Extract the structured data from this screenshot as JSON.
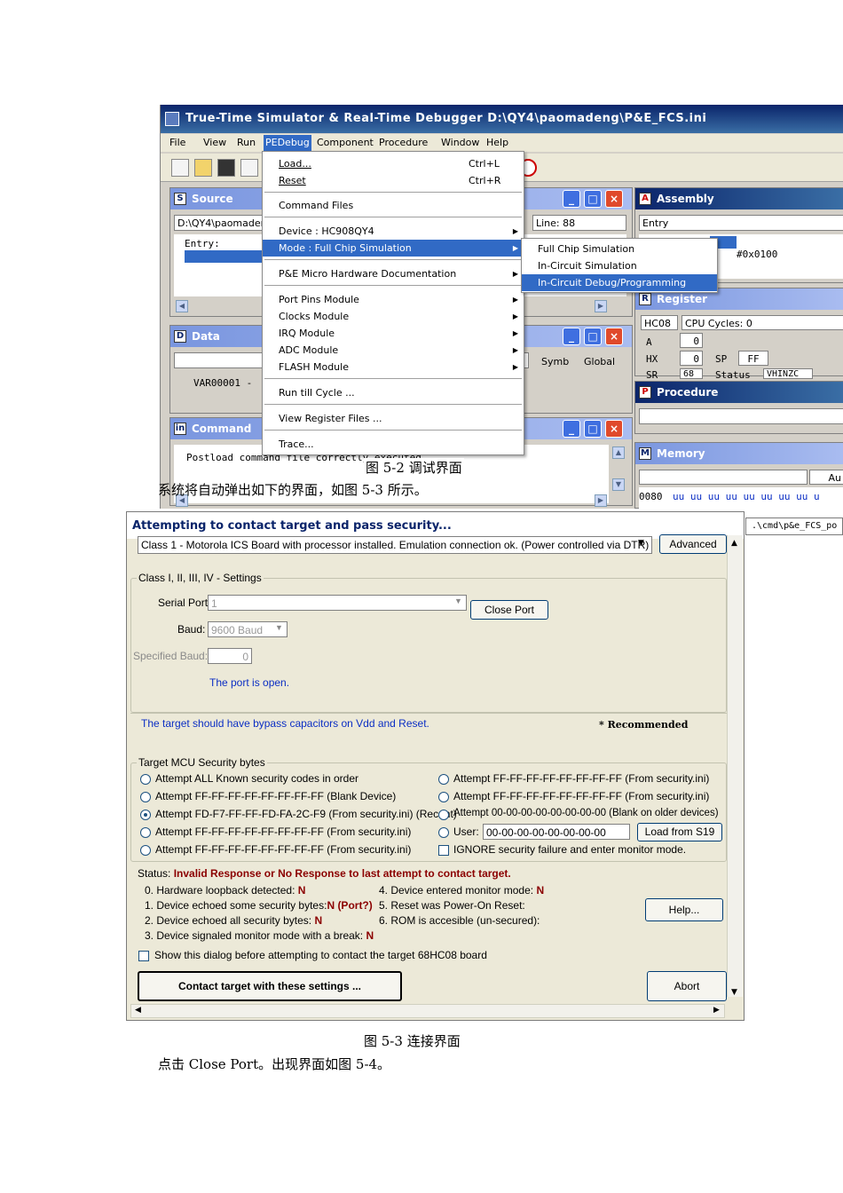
{
  "fig1": {
    "title": "True-Time Simulator & Real-Time Debugger   D:\\QY4\\paomadeng\\P&E_FCS.ini",
    "menu": {
      "file": "File",
      "view": "View",
      "run": "Run",
      "pedebug": "PEDebug",
      "component": "Component",
      "procedure": "Procedure",
      "window": "Window",
      "help": "Help"
    },
    "source": {
      "title": "Source",
      "path": "D:\\QY4\\paomader",
      "line": "Line: 88",
      "entry": "Entry:"
    },
    "data": {
      "title": "Data",
      "var": "VAR00001  -",
      "symb": "Symb",
      "global": "Global"
    },
    "command": {
      "title": "Command",
      "text": "Postload command file correctly executed."
    },
    "assembly": {
      "title": "Assembly",
      "entry": "Entry",
      "value": "#0x0100"
    },
    "register": {
      "title": "Register",
      "cpu": "HC08",
      "cycles": "CPU Cycles:  0",
      "a_label": "A",
      "a_val": "0",
      "hx_label": "HX",
      "hx_val": "0",
      "sp_label": "SP",
      "sp_val": "FF",
      "sr_label": "SR",
      "sr_val": "68",
      "status_label": "Status",
      "status_val": "VHINZC"
    },
    "procedure": {
      "title": "Procedure"
    },
    "memory": {
      "title": "Memory",
      "au": "Au",
      "row_addr": "0080",
      "row_vals": "uu uu uu uu uu uu uu uu  u"
    },
    "cmdpath": ".\\cmd\\p&e_FCS_po",
    "pe_menu": {
      "load": "Load...",
      "load_sc": "Ctrl+L",
      "reset": "Reset",
      "reset_sc": "Ctrl+R",
      "command_files": "Command Files",
      "device": "Device : HC908QY4",
      "mode": "Mode : Full Chip Simulation",
      "docs": "P&E Micro Hardware Documentation",
      "port_pins": "Port Pins Module",
      "clocks": "Clocks Module",
      "irq": "IRQ Module",
      "adc": "ADC Module",
      "flash": "FLASH Module",
      "run_till": "Run till Cycle ...",
      "view_reg": "View Register Files ...",
      "trace": "Trace..."
    },
    "mode_menu": {
      "full": "Full Chip Simulation",
      "incircuit": "In-Circuit Simulation",
      "debug": "In-Circuit Debug/Programming"
    }
  },
  "captions": {
    "fig1": "图 5-2   调试界面",
    "text1": "系统将自动弹出如下的界面，如图 5-3 所示。",
    "fig2": "图 5-3   连接界面",
    "text2": "点击 Close Port。出现界面如图 5-4。"
  },
  "fig2": {
    "title": "Attempting to contact target and pass security...",
    "class_select": "Class 1 - Motorola ICS Board with processor installed. Emulation connection ok. (Power controlled via DTR)",
    "advanced": "Advanced",
    "settings_legend": "Class I, II, III, IV - Settings",
    "serial_port_label": "Serial Port:",
    "serial_port_value": "1",
    "close_port": "Close Port",
    "baud_label": "Baud:",
    "baud_value": "9600 Baud",
    "spec_baud_label": "Specified Baud:",
    "spec_baud_value": "0",
    "port_status": "The port is open.",
    "bypass_note": "The target should have bypass capacitors on Vdd and Reset.",
    "recommended": "* Recommended",
    "security_legend": "Target MCU Security bytes",
    "sec_left": [
      "Attempt ALL Known security codes in order",
      "Attempt FF-FF-FF-FF-FF-FF-FF-FF (Blank Device)",
      "Attempt FD-F7-FF-FF-FD-FA-2C-F9 (From security.ini) (Recent)",
      "Attempt FF-FF-FF-FF-FF-FF-FF-FF (From security.ini)",
      "Attempt FF-FF-FF-FF-FF-FF-FF-FF (From security.ini)"
    ],
    "sec_right": [
      "Attempt FF-FF-FF-FF-FF-FF-FF-FF (From security.ini)",
      "Attempt FF-FF-FF-FF-FF-FF-FF-FF (From security.ini)",
      "Attempt 00-00-00-00-00-00-00-00 (Blank on older devices)"
    ],
    "user_label": "User:",
    "user_value": "00-00-00-00-00-00-00-00",
    "load_s19": "Load from S19",
    "ignore": "IGNORE security failure and enter monitor mode.",
    "status_label": "Status:",
    "status_value": "Invalid Response or No Response to last attempt to contact target.",
    "checks_left": [
      {
        "text": "0. Hardware loopback detected:",
        "val": "N"
      },
      {
        "text": "1. Device echoed some security bytes:",
        "val": "N (Port?)"
      },
      {
        "text": "2. Device echoed all security bytes:",
        "val": "N"
      },
      {
        "text": "3. Device signaled monitor mode with a break:",
        "val": "N"
      }
    ],
    "checks_right": [
      {
        "text": "4. Device entered monitor mode:",
        "val": "N"
      },
      {
        "text": "5. Reset was Power-On Reset:",
        "val": ""
      },
      {
        "text": "6. ROM is accesible (un-secured):",
        "val": ""
      }
    ],
    "help": "Help...",
    "show_dialog": "Show this dialog before attempting to contact the target 68HC08 board",
    "contact": "Contact target with these settings ...",
    "abort": "Abort"
  }
}
